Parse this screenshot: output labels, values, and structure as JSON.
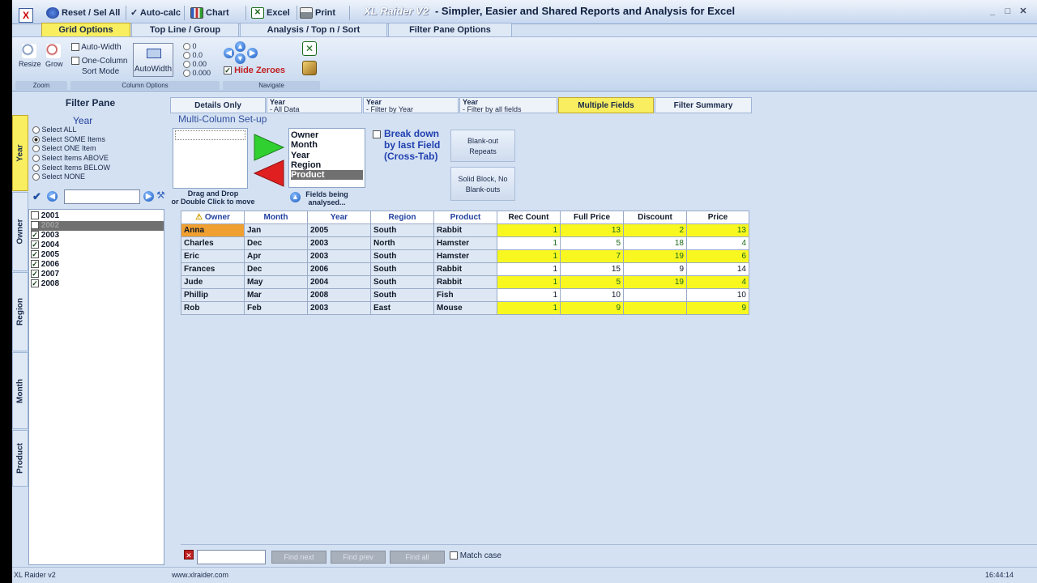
{
  "toolbar": {
    "reset_label": "Reset / Sel All",
    "autocalc_label": "Auto-calc",
    "chart_label": "Chart",
    "excel_label": "Excel",
    "print_label": "Print",
    "brand": "XL Raider V2",
    "title": "Simpler, Easier and Shared Reports and Analysis for Excel"
  },
  "ribbon_tabs": [
    "Grid Options",
    "Top Line / Group",
    "Analysis / Top n / Sort",
    "Filter Pane Options"
  ],
  "ribbon": {
    "resize_label": "Resize",
    "grow_label": "Grow",
    "zoom_group": "Zoom",
    "auto_width_label": "Auto-Width",
    "one_column_label": "One-Column",
    "sort_mode_label": "Sort Mode",
    "autowidth_button": "AutoWidth",
    "column_group": "Column Options",
    "decimals": [
      "0",
      "0.0",
      "0.00",
      "0.000"
    ],
    "hide_zeroes_label": "Hide Zeroes",
    "navigate_group": "Navigate"
  },
  "filter_pane": {
    "title": "Filter Pane",
    "vertical_tabs": [
      "Year",
      "Owner",
      "Region",
      "Month",
      "Product"
    ],
    "heading": "Year",
    "options": [
      "Select ALL",
      "Select SOME Items",
      "Select ONE Item",
      "Select Items ABOVE",
      "Select Items BELOW",
      "Select NONE"
    ],
    "selected_option": "Select SOME Items",
    "items": [
      "2001",
      "2002",
      "2003",
      "2004",
      "2005",
      "2006",
      "2007",
      "2008"
    ]
  },
  "subtabs": {
    "details": "Details Only",
    "year_all_1": "Year",
    "year_all_2": "- All Data",
    "year_by_1": "Year",
    "year_by_2": "- Filter by Year",
    "year_fields_1": "Year",
    "year_fields_2": "- Filter by all fields",
    "multiple": "Multiple Fields",
    "summary": "Filter Summary"
  },
  "setup": {
    "title": "Multi-Column Set-up",
    "drag_label_1": "Drag and Drop",
    "drag_label_2": "or Double Click to move",
    "fields": [
      "Owner",
      "Month",
      "Year",
      "Region",
      "Product"
    ],
    "fields_label_1": "Fields being",
    "fields_label_2": "analysed...",
    "breakdown_1": "Break down",
    "breakdown_2": "by last Field",
    "breakdown_3": "(Cross-Tab)",
    "blank_out_1": "Blank-out",
    "blank_out_2": "Repeats",
    "solid_1": "Solid Block, No",
    "solid_2": "Blank-outs"
  },
  "grid": {
    "headers": [
      "Owner",
      "Month",
      "Year",
      "Region",
      "Product",
      "Rec Count",
      "Full Price",
      "Discount",
      "Price"
    ],
    "rows": [
      [
        "Anna",
        "Jan",
        "2005",
        "South",
        "Rabbit",
        "1",
        "13",
        "2",
        "13"
      ],
      [
        "Charles",
        "Dec",
        "2003",
        "North",
        "Hamster",
        "1",
        "5",
        "18",
        "4"
      ],
      [
        "Eric",
        "Apr",
        "2003",
        "South",
        "Hamster",
        "1",
        "7",
        "19",
        "6"
      ],
      [
        "Frances",
        "Dec",
        "2006",
        "South",
        "Rabbit",
        "1",
        "15",
        "9",
        "14"
      ],
      [
        "Jude",
        "May",
        "2004",
        "South",
        "Rabbit",
        "1",
        "5",
        "19",
        "4"
      ],
      [
        "Phillip",
        "Mar",
        "2008",
        "South",
        "Fish",
        "1",
        "10",
        "",
        "10"
      ],
      [
        "Rob",
        "Feb",
        "2003",
        "East",
        "Mouse",
        "1",
        "9",
        "",
        "9"
      ]
    ]
  },
  "findbar": {
    "find_next": "Find next",
    "find_prev": "Find prev",
    "find_all": "Find all",
    "match_case": "Match case"
  },
  "status": {
    "left": "XL Raider v2",
    "center": "www.xlraider.com",
    "time": "16:44:14"
  },
  "colors": {
    "highlight_yellow": "#f8f820",
    "active_tab": "#f8ee60",
    "selected_owner": "#f0a030"
  }
}
